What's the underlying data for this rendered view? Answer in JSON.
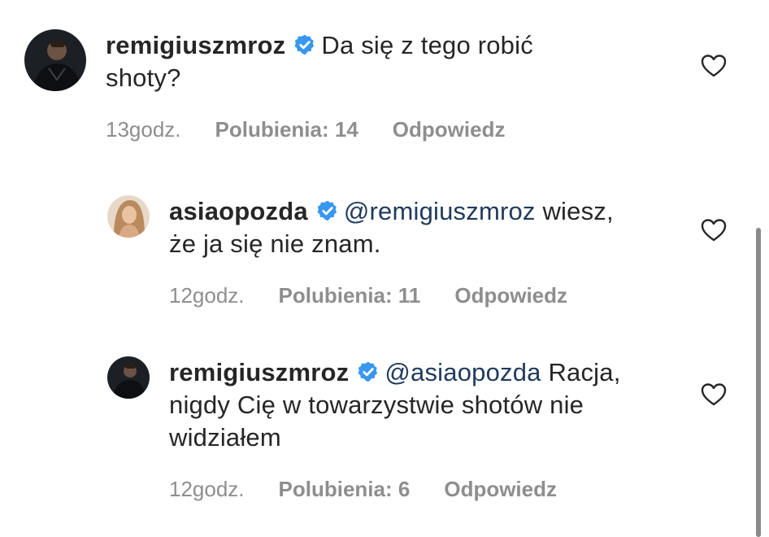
{
  "comments": [
    {
      "username": "remigiuszmroz",
      "mention": "",
      "text_line1": "Da się z tego robić",
      "text_line2": "shoty?",
      "text_line3": "",
      "time": "13godz.",
      "likes": "Polubienia: 14",
      "reply": "Odpowiedz"
    },
    {
      "username": "asiaopozda",
      "mention": "@remigiuszmroz",
      "text_line1": "wiesz,",
      "text_line2": "że ja się nie znam.",
      "text_line3": "",
      "time": "12godz.",
      "likes": "Polubienia: 11",
      "reply": "Odpowiedz"
    },
    {
      "username": "remigiuszmroz",
      "mention": "@asiaopozda",
      "text_line1": "Racja,",
      "text_line2": "nigdy Cię w towarzystwie shotów nie",
      "text_line3": "widziałem",
      "time": "12godz.",
      "likes": "Polubienia: 6",
      "reply": "Odpowiedz"
    }
  ],
  "icons": {
    "verified": "verified-badge-icon",
    "like": "heart-icon"
  },
  "colors": {
    "text": "#262626",
    "meta": "#8e8e8e",
    "mention": "#1f3a5c",
    "verified": "#3897f0"
  }
}
